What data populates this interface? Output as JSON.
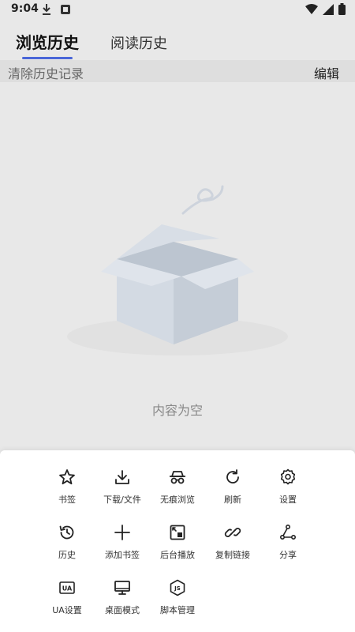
{
  "status_bar": {
    "time": "9:04",
    "left_icons": [
      "download-icon",
      "notification-app-icon"
    ],
    "right_icons": [
      "wifi-icon",
      "signal-icon",
      "battery-icon"
    ]
  },
  "tabs": [
    {
      "label": "浏览历史",
      "active": true
    },
    {
      "label": "阅读历史",
      "active": false
    }
  ],
  "actions": {
    "clear_label": "清除历史记录",
    "edit_label": "编辑"
  },
  "empty_state": {
    "icon": "empty-box-icon",
    "text": "内容为空"
  },
  "menu": {
    "items": [
      {
        "label": "书签",
        "icon": "star-icon"
      },
      {
        "label": "下载/文件",
        "icon": "download-icon"
      },
      {
        "label": "无痕浏览",
        "icon": "incognito-icon"
      },
      {
        "label": "刷新",
        "icon": "refresh-icon"
      },
      {
        "label": "设置",
        "icon": "gear-icon"
      },
      {
        "label": "历史",
        "icon": "history-icon"
      },
      {
        "label": "添加书签",
        "icon": "plus-icon"
      },
      {
        "label": "后台播放",
        "icon": "background-play-icon"
      },
      {
        "label": "复制链接",
        "icon": "link-icon"
      },
      {
        "label": "分享",
        "icon": "share-icon"
      },
      {
        "label": "UA设置",
        "icon": "ua-icon"
      },
      {
        "label": "桌面模式",
        "icon": "desktop-icon"
      },
      {
        "label": "脚本管理",
        "icon": "js-script-icon"
      }
    ]
  },
  "colors": {
    "accent": "#4a66d8",
    "background": "#e8e8e8",
    "sheet": "#ffffff"
  }
}
